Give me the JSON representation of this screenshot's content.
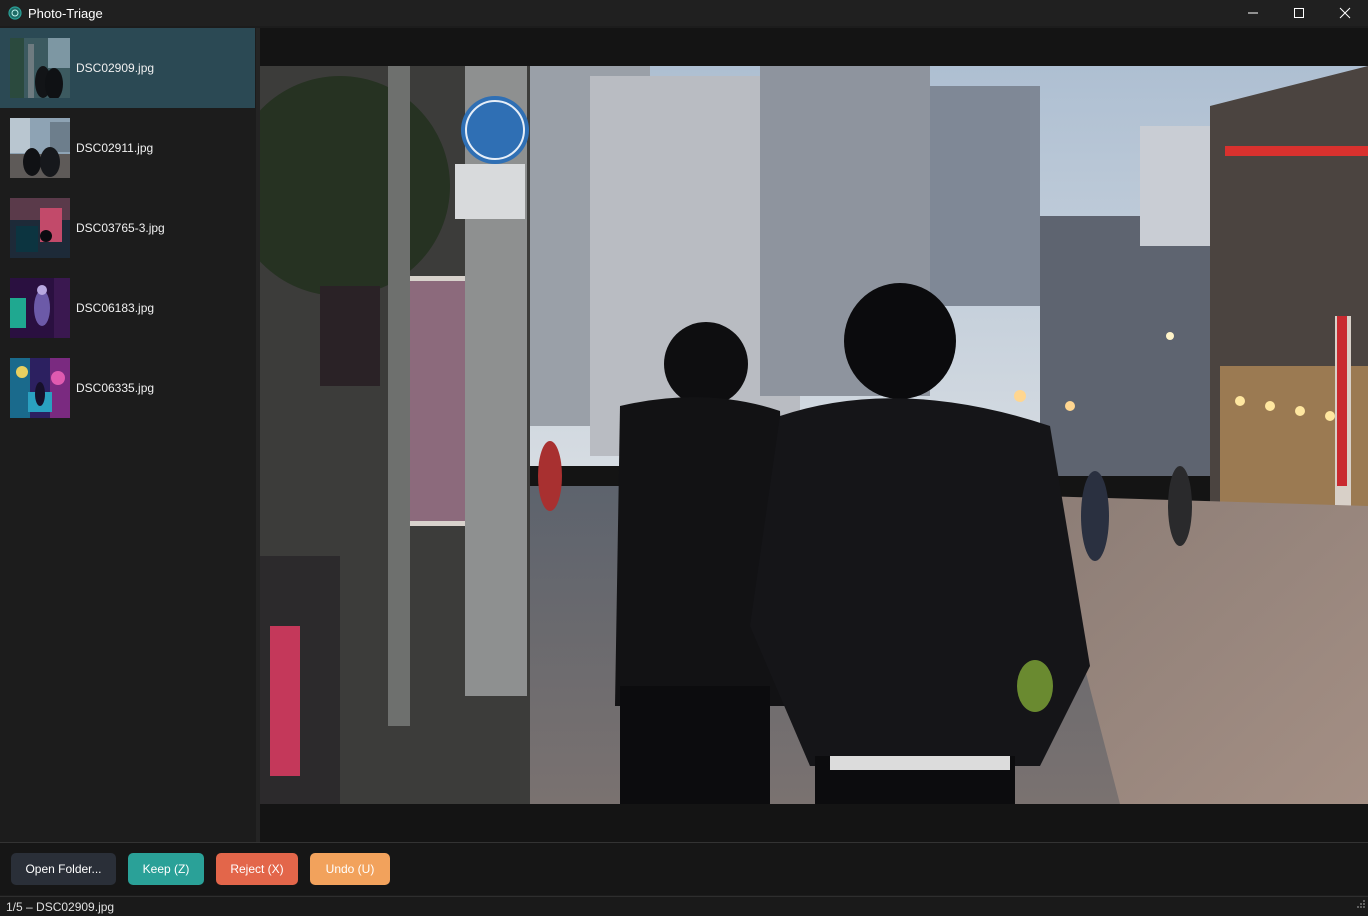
{
  "window": {
    "title": "Photo-Triage",
    "accent_color": "#2aa198",
    "controls": [
      "minimize-icon",
      "maximize-icon",
      "close-icon"
    ]
  },
  "sidebar": {
    "items": [
      {
        "label": "DSC02909.jpg",
        "selected": true
      },
      {
        "label": "DSC02911.jpg",
        "selected": false
      },
      {
        "label": "DSC03765-3.jpg",
        "selected": false
      },
      {
        "label": "DSC06183.jpg",
        "selected": false
      },
      {
        "label": "DSC06335.jpg",
        "selected": false
      }
    ]
  },
  "viewer": {
    "current_file": "DSC02909.jpg"
  },
  "toolbar": {
    "open_label": "Open Folder...",
    "keep_label": "Keep (Z)",
    "reject_label": "Reject (X)",
    "undo_label": "Undo (U)",
    "colors": {
      "open": "#2a2f38",
      "keep": "#2aa198",
      "reject": "#e3664a",
      "undo": "#f2a25c"
    }
  },
  "status": {
    "text": "1/5 – DSC02909.jpg"
  }
}
